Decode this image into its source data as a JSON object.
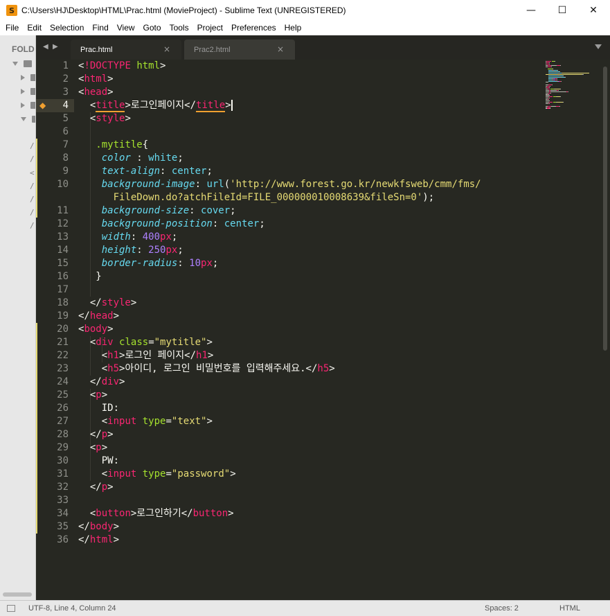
{
  "window": {
    "title": "C:\\Users\\HJ\\Desktop\\HTML\\Prac.html (MovieProject) - Sublime Text (UNREGISTERED)",
    "app_icon_glyph": "S",
    "minimize_glyph": "—",
    "maximize_glyph": "☐",
    "close_glyph": "✕"
  },
  "menu": [
    "File",
    "Edit",
    "Selection",
    "Find",
    "View",
    "Goto",
    "Tools",
    "Project",
    "Preferences",
    "Help"
  ],
  "sidebar": {
    "header": "FOLD",
    "file_glyphs": [
      "/",
      "/",
      "<",
      "/",
      "/",
      "/",
      "/"
    ]
  },
  "tabs": [
    {
      "label": "Prac.html",
      "close": "×",
      "active": true
    },
    {
      "label": "Prac2.html",
      "close": "×",
      "active": false
    }
  ],
  "tab_nav": {
    "prev": "◀",
    "next": "▶"
  },
  "editor": {
    "current_line": 4,
    "line_numbers": [
      "1",
      "2",
      "3",
      "4",
      "5",
      "6",
      "7",
      "8",
      "9",
      "10",
      "",
      "11",
      "12",
      "13",
      "14",
      "15",
      "16",
      "17",
      "18",
      "19",
      "20",
      "21",
      "22",
      "23",
      "24",
      "25",
      "26",
      "27",
      "28",
      "29",
      "30",
      "31",
      "32",
      "33",
      "34",
      "35",
      "36"
    ],
    "lines": [
      [
        [
          "w",
          "<"
        ],
        [
          "t",
          "!DOCTYPE"
        ],
        [
          "w",
          " "
        ],
        [
          "a",
          "html"
        ],
        [
          "w",
          ">"
        ]
      ],
      [
        [
          "w",
          "<"
        ],
        [
          "t",
          "html"
        ],
        [
          "w",
          ">"
        ]
      ],
      [
        [
          "w",
          "<"
        ],
        [
          "t",
          "head"
        ],
        [
          "w",
          ">"
        ]
      ],
      [
        [
          "w",
          "  <"
        ],
        [
          "t ul",
          "title"
        ],
        [
          "w",
          ">로그인페이지</"
        ],
        [
          "t ul",
          "title"
        ],
        [
          "w",
          ">"
        ]
      ],
      [
        [
          "w",
          "  <"
        ],
        [
          "t",
          "style"
        ],
        [
          "w",
          ">"
        ]
      ],
      [],
      [
        [
          "w",
          "   "
        ],
        [
          "a",
          ".mytitle"
        ],
        [
          "w",
          "{"
        ]
      ],
      [
        [
          "w",
          "    "
        ],
        [
          "p",
          "color"
        ],
        [
          "w",
          " : "
        ],
        [
          "f",
          "white"
        ],
        [
          "w",
          ";"
        ]
      ],
      [
        [
          "w",
          "    "
        ],
        [
          "p",
          "text-align"
        ],
        [
          "w",
          ": "
        ],
        [
          "f",
          "center"
        ],
        [
          "w",
          ";"
        ]
      ],
      [
        [
          "w",
          "    "
        ],
        [
          "p",
          "background-image"
        ],
        [
          "w",
          ": "
        ],
        [
          "f",
          "url"
        ],
        [
          "w",
          "("
        ],
        [
          "s",
          "'http://www.forest.go.kr/newkfsweb/cmm/fms/"
        ]
      ],
      [
        [
          "s",
          "      FileDown.do?atchFileId=FILE_000000010008639&fileSn=0'"
        ],
        [
          "w",
          ");"
        ]
      ],
      [
        [
          "w",
          "    "
        ],
        [
          "p",
          "background-size"
        ],
        [
          "w",
          ": "
        ],
        [
          "f",
          "cover"
        ],
        [
          "w",
          ";"
        ]
      ],
      [
        [
          "w",
          "    "
        ],
        [
          "p",
          "background-position"
        ],
        [
          "w",
          ": "
        ],
        [
          "f",
          "center"
        ],
        [
          "w",
          ";"
        ]
      ],
      [
        [
          "w",
          "    "
        ],
        [
          "p",
          "width"
        ],
        [
          "w",
          ": "
        ],
        [
          "n",
          "400"
        ],
        [
          "t",
          "px"
        ],
        [
          "w",
          ";"
        ]
      ],
      [
        [
          "w",
          "    "
        ],
        [
          "p",
          "height"
        ],
        [
          "w",
          ": "
        ],
        [
          "n",
          "250"
        ],
        [
          "t",
          "px"
        ],
        [
          "w",
          ";"
        ]
      ],
      [
        [
          "w",
          "    "
        ],
        [
          "p",
          "border-radius"
        ],
        [
          "w",
          ": "
        ],
        [
          "n",
          "10"
        ],
        [
          "t",
          "px"
        ],
        [
          "w",
          ";"
        ]
      ],
      [
        [
          "w",
          "   }"
        ]
      ],
      [],
      [
        [
          "w",
          "  </"
        ],
        [
          "t",
          "style"
        ],
        [
          "w",
          ">"
        ]
      ],
      [
        [
          "w",
          "</"
        ],
        [
          "t",
          "head"
        ],
        [
          "w",
          ">"
        ]
      ],
      [
        [
          "w",
          "<"
        ],
        [
          "t",
          "body"
        ],
        [
          "w",
          ">"
        ]
      ],
      [
        [
          "w",
          "  <"
        ],
        [
          "t",
          "div"
        ],
        [
          "w",
          " "
        ],
        [
          "a",
          "class"
        ],
        [
          "w",
          "="
        ],
        [
          "s",
          "\"mytitle\""
        ],
        [
          "w",
          ">"
        ]
      ],
      [
        [
          "w",
          "    <"
        ],
        [
          "t",
          "h1"
        ],
        [
          "w",
          ">로그인 페이지</"
        ],
        [
          "t",
          "h1"
        ],
        [
          "w",
          ">"
        ]
      ],
      [
        [
          "w",
          "    <"
        ],
        [
          "t",
          "h5"
        ],
        [
          "w",
          ">아이디, 로그인 비밀번호를 입력해주세요.</"
        ],
        [
          "t",
          "h5"
        ],
        [
          "w",
          ">"
        ]
      ],
      [
        [
          "w",
          "  </"
        ],
        [
          "t",
          "div"
        ],
        [
          "w",
          ">"
        ]
      ],
      [
        [
          "w",
          "  <"
        ],
        [
          "t",
          "p"
        ],
        [
          "w",
          ">"
        ]
      ],
      [
        [
          "w",
          "    ID:"
        ]
      ],
      [
        [
          "w",
          "    <"
        ],
        [
          "t",
          "input"
        ],
        [
          "w",
          " "
        ],
        [
          "a",
          "type"
        ],
        [
          "w",
          "="
        ],
        [
          "s",
          "\"text\""
        ],
        [
          "w",
          ">"
        ]
      ],
      [
        [
          "w",
          "  </"
        ],
        [
          "t",
          "p"
        ],
        [
          "w",
          ">"
        ]
      ],
      [
        [
          "w",
          "  <"
        ],
        [
          "t",
          "p"
        ],
        [
          "w",
          ">"
        ]
      ],
      [
        [
          "w",
          "    PW:"
        ]
      ],
      [
        [
          "w",
          "    <"
        ],
        [
          "t",
          "input"
        ],
        [
          "w",
          " "
        ],
        [
          "a",
          "type"
        ],
        [
          "w",
          "="
        ],
        [
          "s",
          "\"password\""
        ],
        [
          "w",
          ">"
        ]
      ],
      [
        [
          "w",
          "  </"
        ],
        [
          "t",
          "p"
        ],
        [
          "w",
          ">"
        ]
      ],
      [],
      [
        [
          "w",
          "  <"
        ],
        [
          "t",
          "button"
        ],
        [
          "w",
          ">로그인하기</"
        ],
        [
          "t",
          "button"
        ],
        [
          "w",
          ">"
        ]
      ],
      [
        [
          "w",
          "</"
        ],
        [
          "t",
          "body"
        ],
        [
          "w",
          ">"
        ]
      ],
      [
        [
          "w",
          "</"
        ],
        [
          "t",
          "html"
        ],
        [
          "w",
          ">"
        ]
      ]
    ]
  },
  "status": {
    "left": "UTF-8, Line 4, Column 24",
    "spaces": "Spaces: 2",
    "syntax": "HTML"
  },
  "colors": {
    "tag": "#f92672",
    "attribute": "#a6e22e",
    "string": "#e6db74",
    "number": "#ae81ff",
    "property": "#66d9ef",
    "background": "#272822"
  }
}
